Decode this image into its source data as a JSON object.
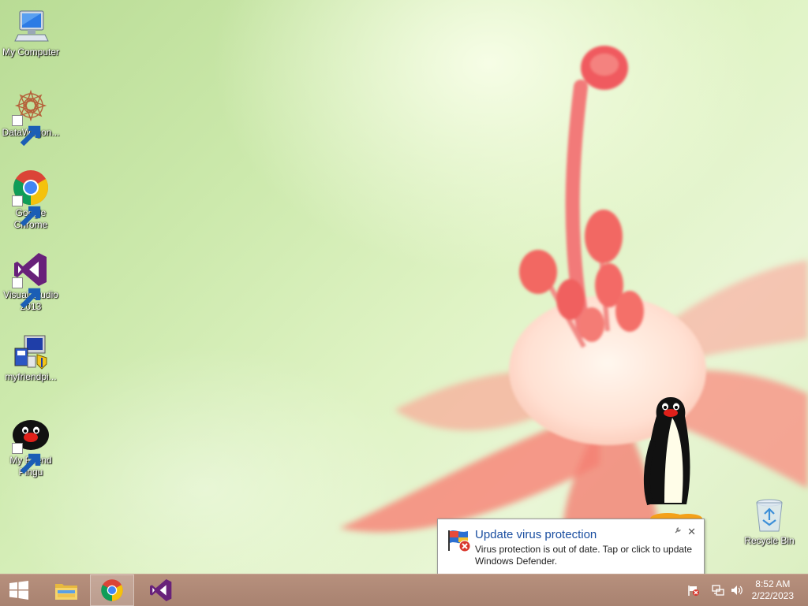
{
  "desktop": {
    "icons": [
      {
        "label": "My Computer",
        "icon": "my-computer-icon"
      },
      {
        "label": "DataWagon...",
        "icon": "datawagon-icon"
      },
      {
        "label": "Google Chrome",
        "icon": "chrome-icon"
      },
      {
        "label": "Visual Studio 2013",
        "icon": "visual-studio-icon"
      },
      {
        "label": "myfriendpi...",
        "icon": "installer-icon"
      },
      {
        "label": "My Friend Pingu",
        "icon": "pingu-icon"
      },
      {
        "label": "Recycle Bin",
        "icon": "recycle-bin-icon"
      }
    ]
  },
  "notification": {
    "title": "Update virus protection",
    "body": "Virus protection is out of date. Tap or click to update Windows Defender.",
    "close": "✕"
  },
  "taskbar": {
    "buttons": [
      {
        "name": "start-button",
        "icon": "windows-logo-icon"
      },
      {
        "name": "file-explorer",
        "icon": "folder-icon"
      },
      {
        "name": "google-chrome",
        "icon": "chrome-icon"
      },
      {
        "name": "visual-studio",
        "icon": "visual-studio-icon"
      }
    ],
    "clock_time": "8:52 AM",
    "clock_date": "2/22/2023"
  },
  "colors": {
    "taskbar": "#a88270",
    "notification_title": "#1a4ea0",
    "vs_purple": "#68217a"
  }
}
